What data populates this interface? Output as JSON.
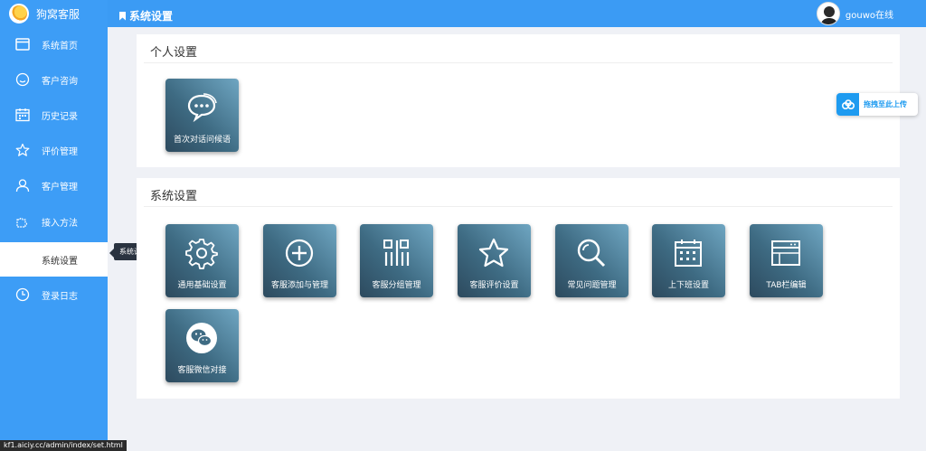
{
  "brand": {
    "name": "狗窝客服"
  },
  "header": {
    "title": "系统设置",
    "username": "gouwo在线"
  },
  "sidebar": {
    "items": [
      {
        "label": "系统首页",
        "icon": "window-icon"
      },
      {
        "label": "客户咨询",
        "icon": "smile-icon"
      },
      {
        "label": "历史记录",
        "icon": "calendar-icon"
      },
      {
        "label": "评价管理",
        "icon": "star-icon"
      },
      {
        "label": "客户管理",
        "icon": "user-icon"
      },
      {
        "label": "接入方法",
        "icon": "puzzle-icon"
      },
      {
        "label": "系统设置",
        "icon": "",
        "active": true
      },
      {
        "label": "登录日志",
        "icon": "clock-icon"
      }
    ],
    "tooltip": "系统设置"
  },
  "personal": {
    "title": "个人设置",
    "tiles": [
      {
        "label": "首次对话问候语",
        "icon": "chat-bubble-icon"
      }
    ]
  },
  "system": {
    "title": "系统设置",
    "tiles": [
      {
        "label": "通用基础设置",
        "icon": "gear-icon"
      },
      {
        "label": "客服添加与管理",
        "icon": "plus-circle-icon"
      },
      {
        "label": "客服分组管理",
        "icon": "grid-columns-icon"
      },
      {
        "label": "客服评价设置",
        "icon": "star-icon"
      },
      {
        "label": "常见问题管理",
        "icon": "search-icon"
      },
      {
        "label": "上下班设置",
        "icon": "calendar-icon"
      },
      {
        "label": "TAB栏编辑",
        "icon": "browser-window-icon"
      },
      {
        "label": "客服微信对接",
        "icon": "wechat-icon"
      }
    ]
  },
  "upload": {
    "label": "拖拽至此上传",
    "icon": "cloud-icon"
  },
  "status_url": "kf1.aiciy.cc/admin/index/set.html",
  "colors": {
    "primary": "#3b9bf4",
    "sidebar": "#3d9df6",
    "tile_dark": "#2d4a5e",
    "tile_light": "#6fa6c2",
    "upload": "#1e9bf0"
  }
}
